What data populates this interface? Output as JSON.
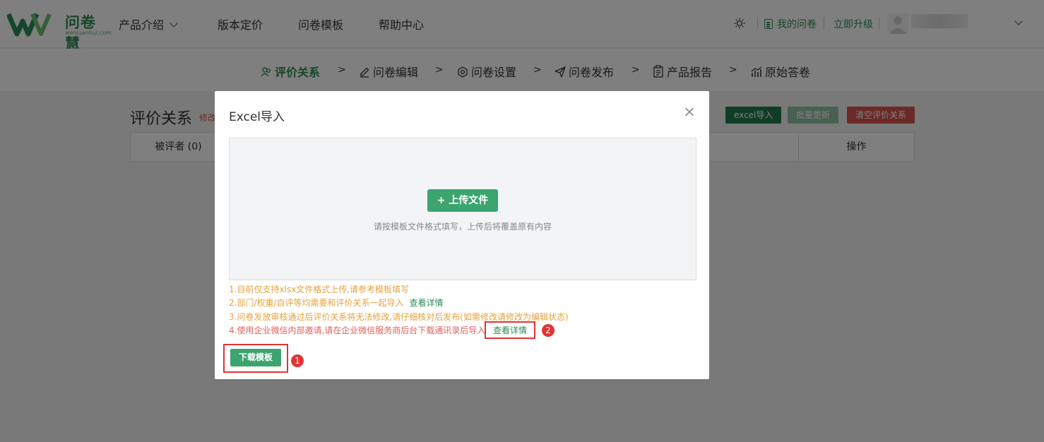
{
  "brand": {
    "name": "问卷慧",
    "domain": "wenjuanhui.com",
    "color": "#2e8b57"
  },
  "nav": {
    "items": [
      {
        "label": "产品介绍",
        "has_dropdown": true
      },
      {
        "label": "版本定价"
      },
      {
        "label": "问卷模板"
      },
      {
        "label": "帮助中心"
      }
    ],
    "my_questionnaires": "我的问卷",
    "upgrade": "立即升级"
  },
  "steps": [
    {
      "label": "评价关系",
      "icon": "users-icon",
      "active": true
    },
    {
      "label": "问卷编辑",
      "icon": "edit-icon"
    },
    {
      "label": "问卷设置",
      "icon": "settings-icon"
    },
    {
      "label": "问卷发布",
      "icon": "send-icon"
    },
    {
      "label": "产品报告",
      "icon": "clipboard-icon"
    },
    {
      "label": "原始答卷",
      "icon": "chart-icon"
    }
  ],
  "step_separator": ">",
  "page": {
    "title": "评价关系",
    "title_sub": "修改",
    "buttons": {
      "excel_import": "excel导入",
      "batch_update": "批量更新",
      "clear_relations": "清空评价关系"
    },
    "table": {
      "col_evaluatee": "被评者 (0)",
      "col_actions": "操作"
    }
  },
  "modal": {
    "title": "Excel导入",
    "upload_button": "+ 上传文件",
    "upload_hint": "请按模板文件格式填写，上传后将覆盖原有内容",
    "notes": [
      {
        "text": "1.目前仅支持xlsx文件格式上传,请参考模板填写"
      },
      {
        "text": "2.部门/权重/自评等均需要和评价关系一起导入",
        "link": "查看详情"
      },
      {
        "text": "3.问卷发放审核通过后评价关系将无法修改,请仔细核对后发布(如需修改请修改为编辑状态)"
      },
      {
        "text": "4.使用企业微信内部邀请,请在企业微信服务商后台下载通讯录后导入",
        "link": "查看详情"
      }
    ],
    "download_template": "下载模板",
    "annotations": {
      "badge1": "1",
      "badge2": "2"
    }
  },
  "colors": {
    "primary": "#3ba46f",
    "dark_green": "#1f7a4a",
    "muted_green": "#8fc0a2",
    "danger": "#d9534f",
    "annotation": "#e23434",
    "note_orange": "#e6a23c",
    "note_red": "#e0615a"
  }
}
